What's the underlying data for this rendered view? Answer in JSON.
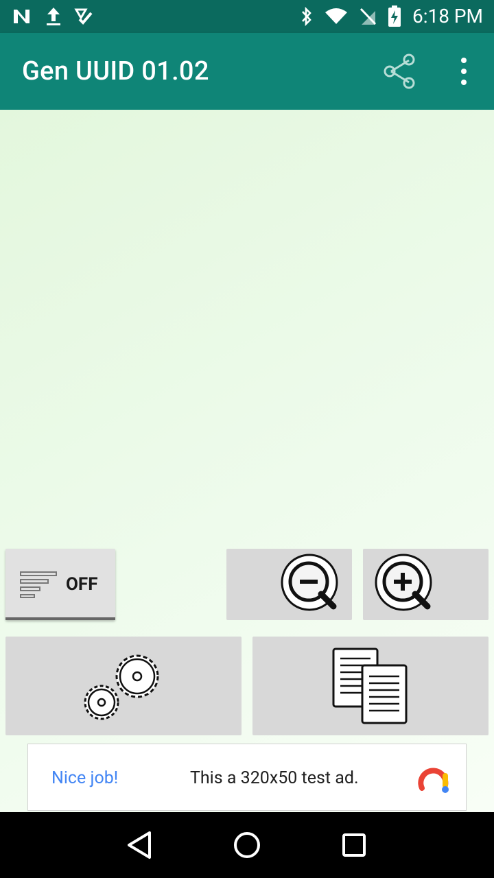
{
  "status_bar": {
    "time": "6:18 PM",
    "icons": [
      "n-icon",
      "upload-icon",
      "task-done-icon",
      "bluetooth-icon",
      "wifi-icon",
      "no-sim-icon",
      "battery-charging-icon"
    ]
  },
  "app_bar": {
    "title": "Gen UUID 01.02",
    "actions": [
      "share-icon",
      "more-vert-icon"
    ]
  },
  "controls": {
    "toggle_label": "OFF",
    "zoom_out_icon": "zoom-out-icon",
    "zoom_in_icon": "zoom-in-icon",
    "generate_icon": "gears-icon",
    "copy_icon": "copy-icon"
  },
  "ad": {
    "title": "Nice job!",
    "text": "This a 320x50 test ad.",
    "icon": "ad-logo-icon"
  },
  "nav_bar": {
    "buttons": [
      "back-icon",
      "home-icon",
      "recents-icon"
    ]
  },
  "colors": {
    "status_bar": "#0b6a5e",
    "app_bar": "#0f8577",
    "content_bg": "#e8f8e4",
    "button_bg": "#d8d8d8",
    "ad_title": "#4285f4"
  }
}
